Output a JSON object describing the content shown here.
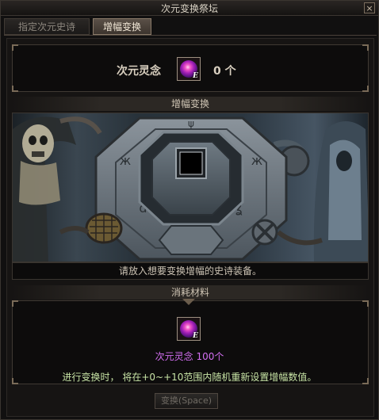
{
  "window": {
    "title": "次元变换祭坛",
    "close_glyph": "×"
  },
  "tabs": [
    {
      "label": "指定次元史诗",
      "active": false
    },
    {
      "label": "增幅变换",
      "active": true
    }
  ],
  "material_header": {
    "name": "次元灵念",
    "count": "0 个",
    "icon": "dimension-soul-gem-icon",
    "icon_badge": "E"
  },
  "conversion": {
    "section_label": "增幅变换",
    "instruction": "请放入想要变换增幅的史诗装备。",
    "slot_icon": "equipment-slot-icon"
  },
  "consumables": {
    "section_label": "消耗材料",
    "icon_badge": "E",
    "requirement": "次元灵念 100个",
    "description": "进行变换时， 将在+0~+10范围内随机重新设置增幅数值。",
    "button_label": "变换(Space)"
  },
  "colors": {
    "requirement_text": "#d36ff2",
    "description_text": "#c7e3a5",
    "active_tab": "#5a5047"
  }
}
